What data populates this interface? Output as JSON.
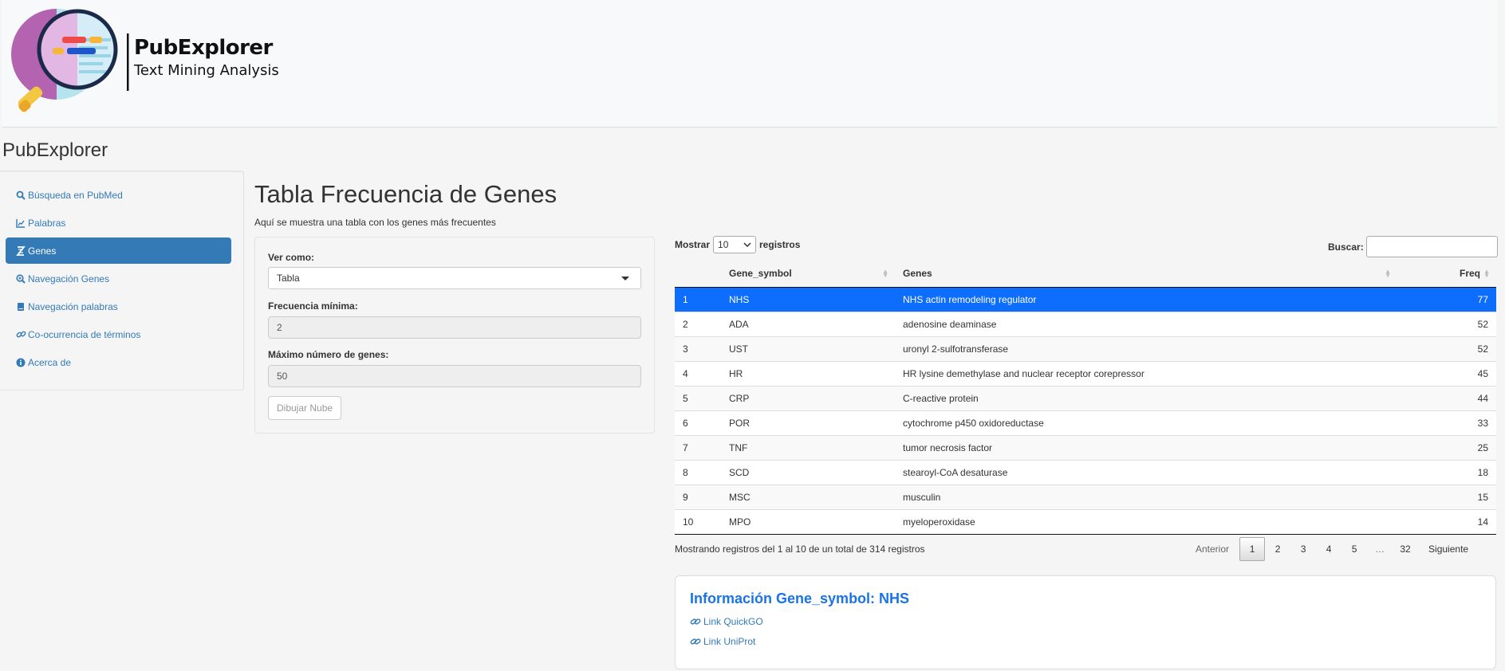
{
  "brand": {
    "name": "PubExplorer",
    "tagline": "Text Mining Analysis"
  },
  "app_title": "PubExplorer",
  "sidebar": {
    "items": [
      {
        "label": "Búsqueda en PubMed",
        "icon": "search-icon",
        "active": false
      },
      {
        "label": "Palabras",
        "icon": "chart-line-icon",
        "active": false
      },
      {
        "label": "Genes",
        "icon": "dna-icon",
        "active": true
      },
      {
        "label": "Navegación Genes",
        "icon": "search-plus-icon",
        "active": false
      },
      {
        "label": "Navegación palabras",
        "icon": "book-icon",
        "active": false
      },
      {
        "label": "Co-ocurrencia de términos",
        "icon": "link-icon",
        "active": false
      },
      {
        "label": "Acerca de",
        "icon": "info-circle-icon",
        "active": false
      }
    ]
  },
  "page": {
    "title": "Tabla Frecuencia de Genes",
    "subtitle": "Aquí se muestra una tabla con los genes más frecuentes"
  },
  "controls": {
    "view_label": "Ver como:",
    "view_value": "Tabla",
    "min_freq_label": "Frecuencia mínima:",
    "min_freq_value": "2",
    "max_genes_label": "Máximo número de genes:",
    "max_genes_value": "50",
    "draw_button": "Dibujar Nube"
  },
  "table": {
    "length_prefix": "Mostrar",
    "length_value": "10",
    "length_suffix": "registros",
    "search_label": "Buscar:",
    "search_value": "",
    "columns": [
      "",
      "Gene_symbol",
      "Genes",
      "Freq"
    ],
    "rows": [
      {
        "idx": "1",
        "symbol": "NHS",
        "gene": "NHS actin remodeling regulator",
        "freq": "77",
        "selected": true
      },
      {
        "idx": "2",
        "symbol": "ADA",
        "gene": "adenosine deaminase",
        "freq": "52"
      },
      {
        "idx": "3",
        "symbol": "UST",
        "gene": "uronyl 2-sulfotransferase",
        "freq": "52"
      },
      {
        "idx": "4",
        "symbol": "HR",
        "gene": "HR lysine demethylase and nuclear receptor corepressor",
        "freq": "45"
      },
      {
        "idx": "5",
        "symbol": "CRP",
        "gene": "C-reactive protein",
        "freq": "44"
      },
      {
        "idx": "6",
        "symbol": "POR",
        "gene": "cytochrome p450 oxidoreductase",
        "freq": "33"
      },
      {
        "idx": "7",
        "symbol": "TNF",
        "gene": "tumor necrosis factor",
        "freq": "25"
      },
      {
        "idx": "8",
        "symbol": "SCD",
        "gene": "stearoyl-CoA desaturase",
        "freq": "18"
      },
      {
        "idx": "9",
        "symbol": "MSC",
        "gene": "musculin",
        "freq": "15"
      },
      {
        "idx": "10",
        "symbol": "MPO",
        "gene": "myeloperoxidase",
        "freq": "14"
      }
    ],
    "info": "Mostrando registros del 1 al 10 de un total de 314 registros",
    "pagination": [
      "Anterior",
      "1",
      "2",
      "3",
      "4",
      "5",
      "…",
      "32",
      "Siguiente"
    ],
    "current_page": "1"
  },
  "info_card": {
    "title": "Información Gene_symbol: NHS",
    "links": [
      "Link QuickGO",
      "Link UniProt"
    ]
  },
  "colors": {
    "accent": "#337ab7",
    "selected_row": "#0d6efd",
    "card_title": "#1a73e8"
  }
}
